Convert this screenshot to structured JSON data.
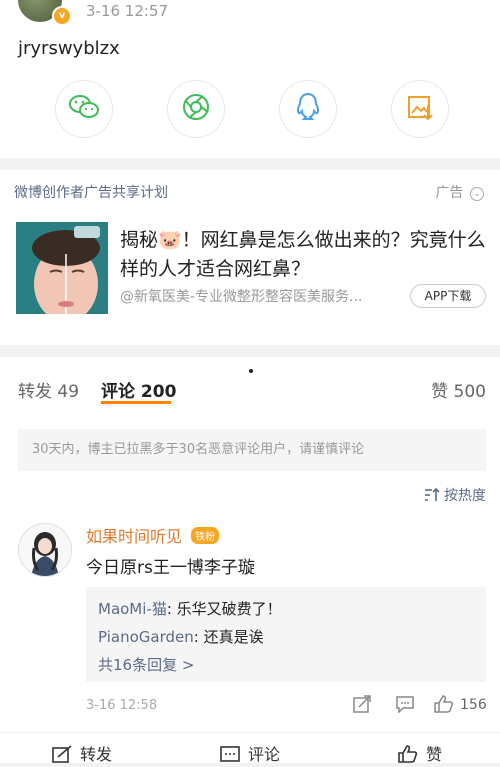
{
  "post": {
    "time": "3-16 12:57",
    "text": "jryrswyblzx",
    "badge": "v",
    "share_icons": [
      "wechat-icon",
      "moments-icon",
      "qq-icon",
      "save-image-icon"
    ]
  },
  "ad": {
    "label": "微博创作者广告共享计划",
    "tag": "广告",
    "tag_chevron": "⌄",
    "title": "揭秘🐷！网红鼻是怎么做出来的？究竟什么样的人才适合网红鼻？",
    "source": "@新氧医美-专业微整形整容医美服务...",
    "button": "APP下载"
  },
  "tabs": {
    "repost": "转发 49",
    "comment": "评论 200",
    "like": "赞 500"
  },
  "notice": "30天内，博主已拉黑多于30名恶意评论用户，请谨慎评论",
  "sort_label": "按热度",
  "comment": {
    "user": "如果时间听见",
    "fan_badge": "铁粉",
    "text": "今日原rs王一博李子璇",
    "replies": [
      {
        "name": "MaoMi-猫",
        "text": ": 乐华又破费了！"
      },
      {
        "name": "PianoGarden",
        "text": ": 还真是诶"
      }
    ],
    "more": "共16条回复 >",
    "time": "3-16 12:58",
    "likes": "156"
  },
  "bottom_bar": {
    "repost": "转发",
    "comment": "评论",
    "like": "赞"
  },
  "colors": {
    "accent_orange": "#ff8200",
    "link_blue": "#5b6b8a",
    "wechat_green": "#3dbd55",
    "qq_blue": "#4aa0e6",
    "save_orange": "#f0a030"
  }
}
